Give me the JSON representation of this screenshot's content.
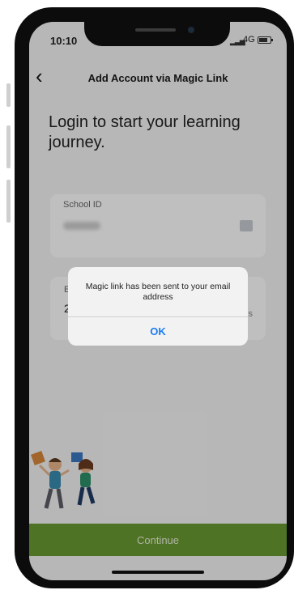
{
  "status_bar": {
    "time": "10:10",
    "network": "4G",
    "battery_level": 0.8
  },
  "header": {
    "title": "Add Account via Magic Link"
  },
  "headline": "Login to start your learning journey.",
  "school_field": {
    "label": "School ID"
  },
  "email_field": {
    "label_partial": "E",
    "value_partial": "2",
    "hint_partial": "s"
  },
  "continue_button": {
    "label": "Continue"
  },
  "alert": {
    "message": "Magic link has been sent to your email address",
    "ok_label": "OK"
  },
  "colors": {
    "accent_green": "#6a9a30",
    "link_blue": "#1a7cf2"
  }
}
